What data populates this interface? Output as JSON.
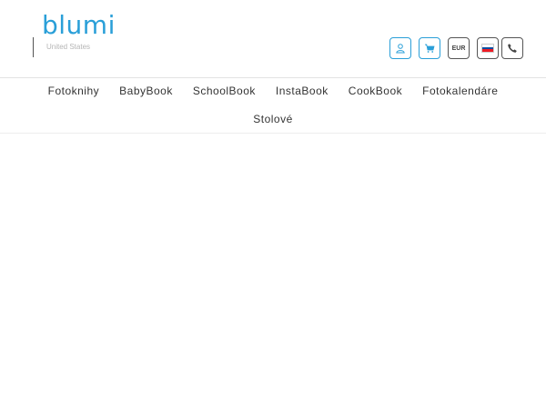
{
  "brand": {
    "logo_text": "blumi",
    "region": "United States"
  },
  "header_actions": {
    "account_icon": "user-icon",
    "cart_icon": "cart-icon",
    "currency": "EUR",
    "language_flag": "slovakia-flag-icon",
    "phone_icon": "phone-icon"
  },
  "nav": {
    "items": [
      "Fotoknihy",
      "BabyBook",
      "SchoolBook",
      "InstaBook",
      "CookBook",
      "Fotokalendáre",
      "Stolové"
    ]
  },
  "colors": {
    "accent": "#2a9fd8",
    "border_dark": "#555555",
    "text": "#333333"
  }
}
